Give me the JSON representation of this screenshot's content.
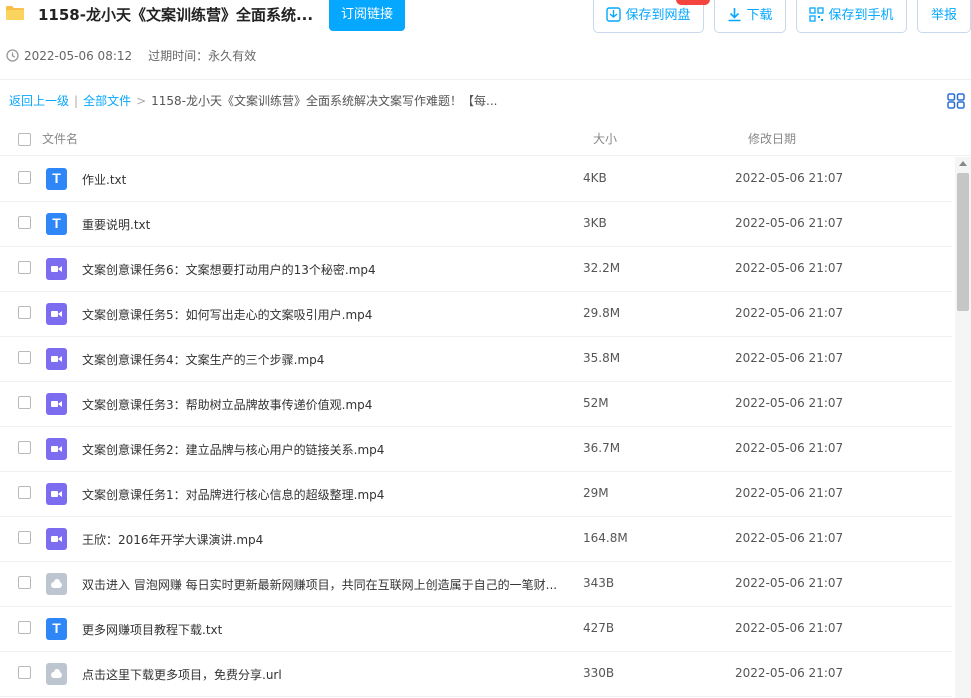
{
  "header": {
    "title": "1158-龙小天《文案训练营》全面系统...",
    "subscribe_label": "订阅链接",
    "save_disk_label": "保存到网盘",
    "download_label": "下载",
    "save_phone_label": "保存到手机",
    "report_label": "举报",
    "date": "2022-05-06 08:12",
    "expire_text": "过期时间：永久有效"
  },
  "breadcrumb": {
    "back": "返回上一级",
    "all_files": "全部文件",
    "current": "1158-龙小天《文案训练营》全面系统解决文案写作难题！【每..."
  },
  "table": {
    "col_name": "文件名",
    "col_size": "大小",
    "col_date": "修改日期",
    "rows": [
      {
        "type": "txt",
        "name": "作业.txt",
        "size": "4KB",
        "date": "2022-05-06 21:07"
      },
      {
        "type": "txt",
        "name": "重要说明.txt",
        "size": "3KB",
        "date": "2022-05-06 21:07"
      },
      {
        "type": "video",
        "name": "文案创意课任务6：文案想要打动用户的13个秘密.mp4",
        "size": "32.2M",
        "date": "2022-05-06 21:07"
      },
      {
        "type": "video",
        "name": "文案创意课任务5：如何写出走心的文案吸引用户.mp4",
        "size": "29.8M",
        "date": "2022-05-06 21:07"
      },
      {
        "type": "video",
        "name": "文案创意课任务4：文案生产的三个步骤.mp4",
        "size": "35.8M",
        "date": "2022-05-06 21:07"
      },
      {
        "type": "video",
        "name": "文案创意课任务3：帮助树立品牌故事传递价值观.mp4",
        "size": "52M",
        "date": "2022-05-06 21:07"
      },
      {
        "type": "video",
        "name": "文案创意课任务2：建立品牌与核心用户的链接关系.mp4",
        "size": "36.7M",
        "date": "2022-05-06 21:07"
      },
      {
        "type": "video",
        "name": "文案创意课任务1：对品牌进行核心信息的超级整理.mp4",
        "size": "29M",
        "date": "2022-05-06 21:07"
      },
      {
        "type": "video",
        "name": "王欣：2016年开学大课演讲.mp4",
        "size": "164.8M",
        "date": "2022-05-06 21:07"
      },
      {
        "type": "link",
        "name": "双击进入 冒泡网赚 每日实时更新最新网赚项目，共同在互联网上创造属于自己的一笔财...",
        "size": "343B",
        "date": "2022-05-06 21:07"
      },
      {
        "type": "txt",
        "name": "更多网赚项目教程下载.txt",
        "size": "427B",
        "date": "2022-05-06 21:07"
      },
      {
        "type": "link",
        "name": "点击这里下载更多项目，免费分享.url",
        "size": "330B",
        "date": "2022-05-06 21:07"
      }
    ]
  },
  "colors": {
    "accent": "#06a7ff",
    "txt_icon": "#2f86f6",
    "video_icon": "#7b6cf0",
    "link_icon": "#bdc6d0"
  }
}
